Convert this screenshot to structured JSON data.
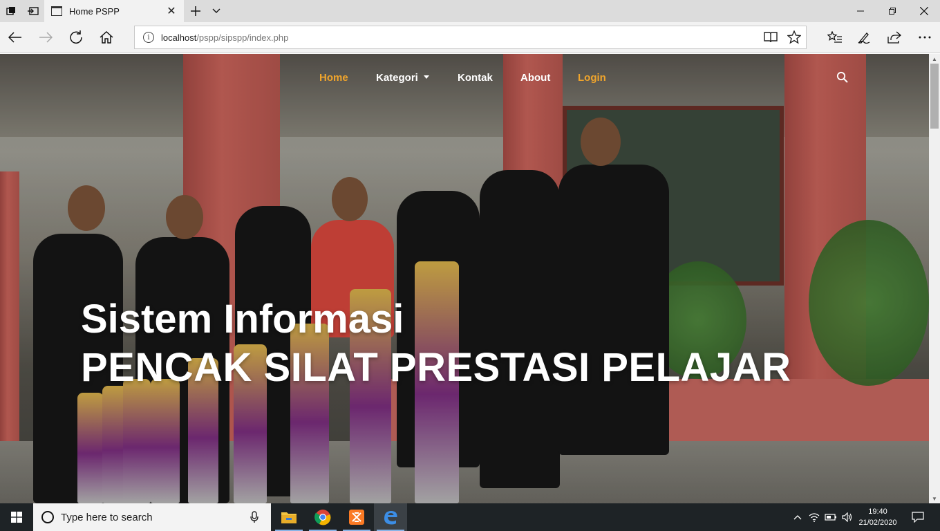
{
  "browser": {
    "tab_title": "Home PSPP",
    "address": {
      "host": "localhost",
      "path": "/pspp/sipspp/index.php"
    }
  },
  "site": {
    "nav": {
      "home": "Home",
      "kategori": "Kategori",
      "kontak": "Kontak",
      "about": "About",
      "login": "Login"
    },
    "accent_color": "#f0a52c",
    "hero": {
      "line1": "Sistem Informasi",
      "line2": "PENCAK SILAT PRESTASI PELAJAR"
    }
  },
  "taskbar": {
    "search_placeholder": "Type here to search",
    "time": "19:40",
    "date": "21/02/2020",
    "apps": [
      "file-explorer-icon",
      "chrome-icon",
      "xampp-icon",
      "edge-icon"
    ]
  }
}
